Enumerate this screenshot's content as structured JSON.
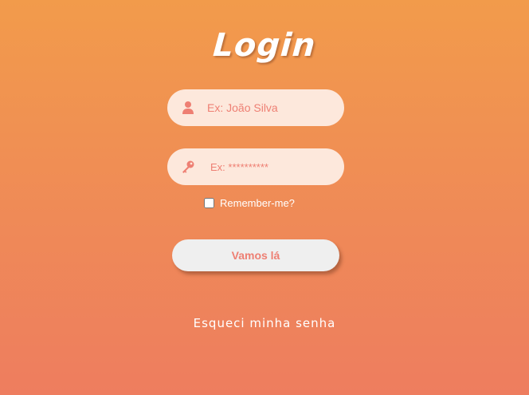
{
  "page": {
    "title": "Login"
  },
  "form": {
    "username": {
      "icon": "user-icon",
      "placeholder": "Ex: João Silva",
      "value": ""
    },
    "password": {
      "icon": "key-icon",
      "placeholder": "Ex: **********",
      "value": ""
    },
    "remember": {
      "label": "Remember-me?",
      "checked": false
    },
    "submit_label": "Vamos lá",
    "forgot_label": "Esqueci minha senha"
  },
  "colors": {
    "background_top": "#f29b4b",
    "background_bottom": "#ee7d5f",
    "field_background": "#fde8dc",
    "accent": "#ee7f73",
    "button_background": "#efefef",
    "text_light": "#ffffff"
  }
}
